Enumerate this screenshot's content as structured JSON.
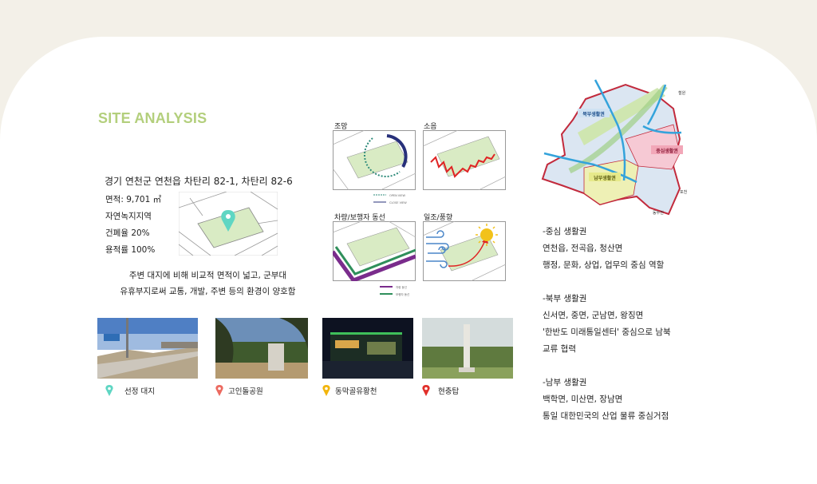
{
  "title": "SITE ANALYSIS",
  "site": {
    "address": "경기 연천군 연천읍 차탄리 82-1, 차탄리 82-6",
    "facts": [
      "면적: 9,701 ㎡",
      "자연녹지지역",
      "건폐율 20%",
      "용적률 100%"
    ],
    "description": [
      "주변 대지에 비해 비교적 면적이 넓고, 군부대",
      "유휴부지로써 교통, 개발, 주변 등의 환경이 양호함"
    ]
  },
  "diagrams": {
    "view": {
      "label": "조망",
      "legend": [
        "OPEN VIEW",
        "CLOSE VIEW"
      ]
    },
    "noise": {
      "label": "소음"
    },
    "traffic": {
      "label": "차량/보행자 동선",
      "legend": [
        "차량 동선",
        "보행자 동선"
      ]
    },
    "sun_wind": {
      "label": "일조/풍향"
    }
  },
  "places": [
    {
      "label": "선정 대지",
      "pin_color": "#5fd6c3"
    },
    {
      "label": "고인돌공원",
      "pin_color": "#ec6a60"
    },
    {
      "label": "동막골유황천",
      "pin_color": "#f2b50c"
    },
    {
      "label": "현충탑",
      "pin_color": "#e12f2a"
    }
  ],
  "region_map": {
    "labels": [
      "북부생활권",
      "중심생활권",
      "남부생활권",
      "철원",
      "포천",
      "동두천"
    ]
  },
  "zones": [
    {
      "title": "-중심 생활권",
      "lines": [
        "연천읍, 전곡읍, 청산면",
        "행정, 문화, 상업, 업무의 중심 역할"
      ]
    },
    {
      "title": "-북부 생활권",
      "lines": [
        "신서면, 중면, 군남면, 왕징면",
        "'한반도 미래통일센터' 중심으로 남북",
        "교류 협력"
      ]
    },
    {
      "title": "-남부 생활권",
      "lines": [
        "백학면, 미산면, 장남면",
        "통일 대한민국의 산업 물류 중심거점"
      ]
    }
  ]
}
